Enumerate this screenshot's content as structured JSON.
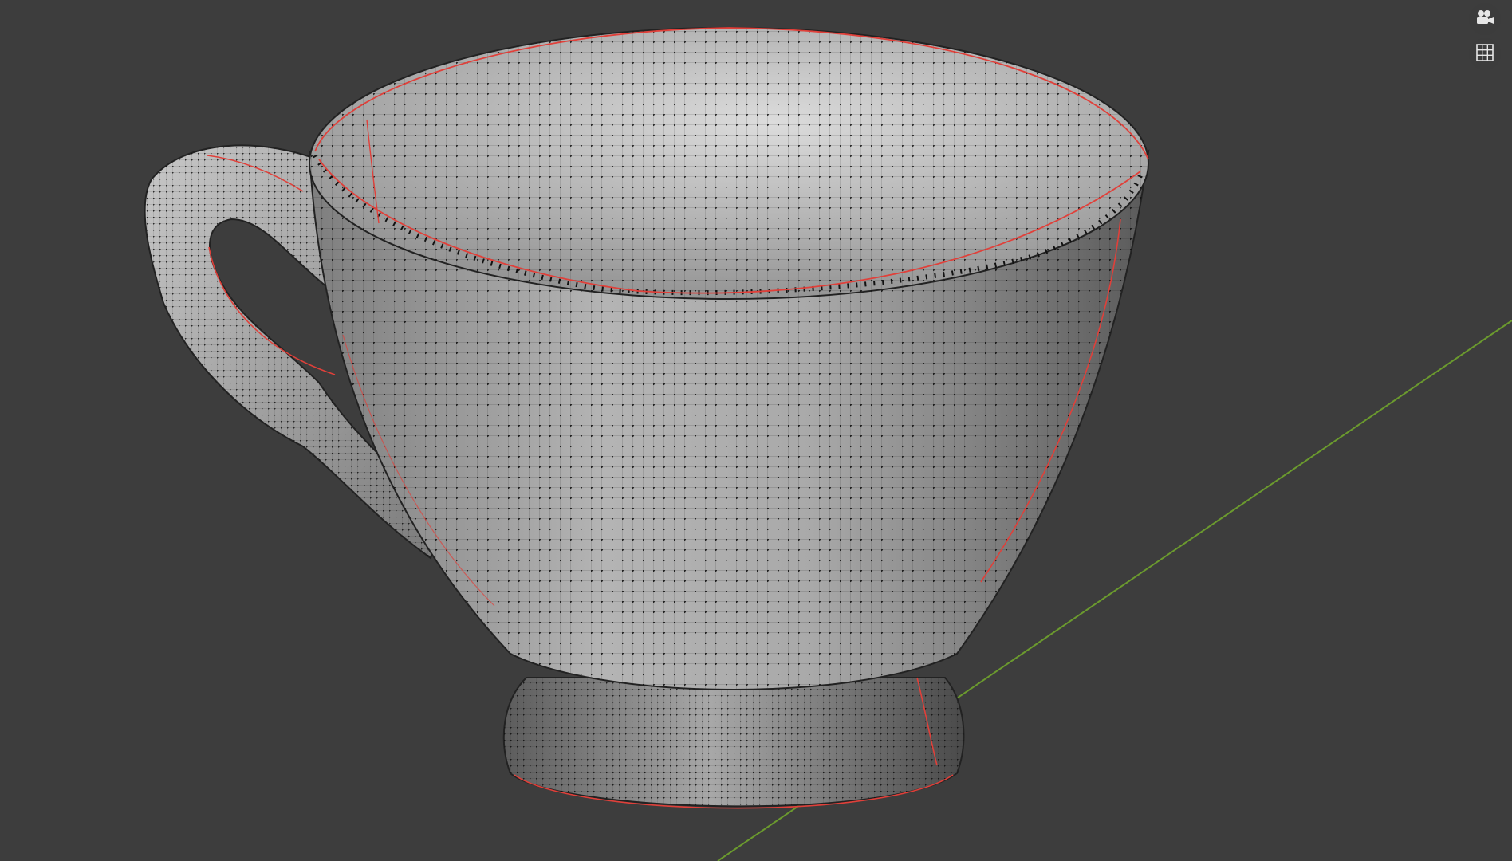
{
  "viewport": {
    "background": "#3d3d3d",
    "object": "teacup-mesh",
    "display_mode": "solid-with-wireframe-vertices",
    "mesh_color": "#b9b9b9",
    "wire_color": "#1a1a1a",
    "seam_color": "#e0403a",
    "axis_color": "#6b9a2e"
  },
  "overlay_buttons": [
    {
      "name": "camera-view-button",
      "icon": "camera-icon"
    },
    {
      "name": "ortho-toggle-button",
      "icon": "grid-icon"
    }
  ]
}
